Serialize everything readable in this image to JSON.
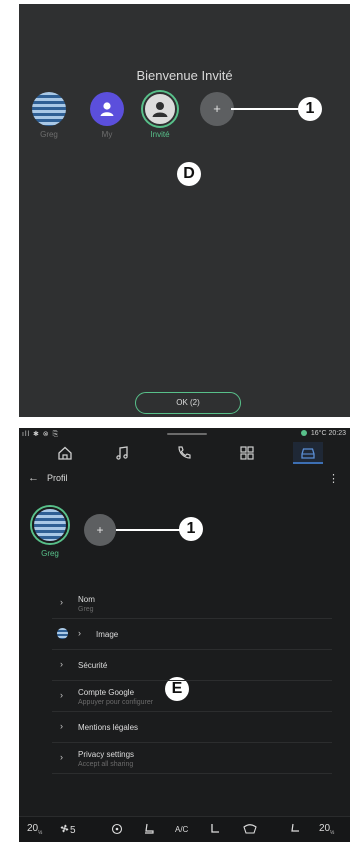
{
  "panel1": {
    "welcome_title": "Bienvenue Invité",
    "profiles": [
      {
        "label": "Greg"
      },
      {
        "label": "My"
      },
      {
        "label": "Invité"
      }
    ],
    "add_profile_symbol": "+",
    "callout_1": "1",
    "callout_d": "D",
    "ok_button": "OK (2)"
  },
  "panel2": {
    "status": {
      "left_icons": "ıll ✱ ⊗ ⎘",
      "temperature": "16°C",
      "time": "20:23"
    },
    "nav": {
      "items": [
        "home-icon",
        "music-icon",
        "phone-icon",
        "apps-icon",
        "car-icon"
      ],
      "active": "car-icon"
    },
    "header": {
      "back_symbol": "←",
      "title": "Profil",
      "kebab_symbol": "⋮"
    },
    "profile": {
      "name": "Greg",
      "add_symbol": "+"
    },
    "callout_1": "1",
    "callout_e": "E",
    "menu": {
      "nom": {
        "title": "Nom",
        "subtitle": "Greg"
      },
      "image": {
        "title": "Image"
      },
      "securite": {
        "title": "Sécurité"
      },
      "compte_google": {
        "title": "Compte Google",
        "subtitle": "Appuyer pour configurer"
      },
      "mentions": {
        "title": "Mentions légales"
      },
      "privacy": {
        "title": "Privacy settings",
        "subtitle": "Accept all sharing"
      },
      "chevron": "›"
    },
    "bottom_bar": {
      "temp_left": "20",
      "temp_left_sup": "½",
      "fan_speed": "5",
      "ac_label": "A/C",
      "temp_right": "20",
      "temp_right_sup": "½"
    }
  }
}
